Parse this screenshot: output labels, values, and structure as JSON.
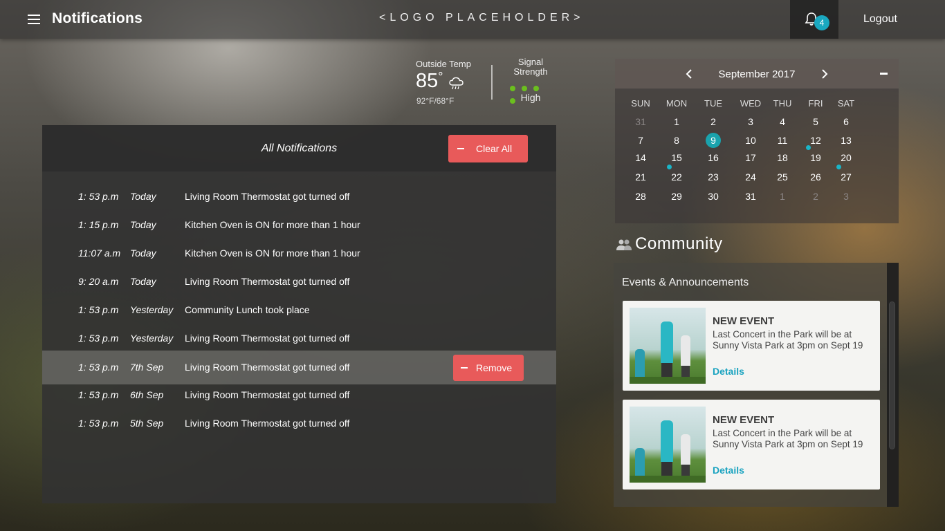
{
  "topbar": {
    "page_title": "Notifications",
    "logo": "<LOGO PLACEHOLDER>",
    "notification_count": "4",
    "logout_label": "Logout"
  },
  "weather": {
    "temp_label": "Outside Temp",
    "temp_value": "85",
    "temp_unit": "°",
    "icon": "rain-cloud-icon",
    "range": "92°F/68°F",
    "signal_label": "Signal Strength",
    "signal_bars": 4,
    "signal_value": "High",
    "signal_color": "#6bbf1e"
  },
  "notifications": {
    "title": "All Notifications",
    "clear_label": "Clear All",
    "remove_label": "Remove",
    "rows": [
      {
        "time": "1: 53 p.m",
        "day": "Today",
        "text": "Living Room Thermostat got turned off"
      },
      {
        "time": "1: 15 p.m",
        "day": "Today",
        "text": "Kitchen Oven is ON for more than 1 hour"
      },
      {
        "time": "11:07 a.m",
        "day": "Today",
        "text": "Kitchen Oven is ON for more than 1 hour"
      },
      {
        "time": "9: 20 a.m",
        "day": "Today",
        "text": "Living Room Thermostat got turned off"
      },
      {
        "time": "1: 53 p.m",
        "day": "Yesterday",
        "text": "Community Lunch took place"
      },
      {
        "time": "1: 53 p.m",
        "day": "Yesterday",
        "text": "Living Room Thermostat got turned off"
      },
      {
        "time": "1: 53 p.m",
        "day": "7th Sep",
        "text": "Living Room Thermostat got turned off"
      },
      {
        "time": "1: 53 p.m",
        "day": "6th Sep",
        "text": "Living Room Thermostat got turned off"
      },
      {
        "time": "1: 53 p.m",
        "day": "5th Sep",
        "text": "Living Room Thermostat got turned off"
      }
    ]
  },
  "calendar": {
    "month": "September 2017",
    "weekdays": [
      "SUN",
      "MON",
      "TUE",
      "WED",
      "THU",
      "FRI",
      "SAT"
    ],
    "weeks": [
      [
        "31",
        "1",
        "2",
        "3",
        "4",
        "5",
        "6"
      ],
      [
        "7",
        "8",
        "9",
        "10",
        "11",
        "12",
        "13"
      ],
      [
        "14",
        "15",
        "16",
        "17",
        "18",
        "19",
        "20"
      ],
      [
        "21",
        "22",
        "23",
        "24",
        "25",
        "26",
        "27"
      ],
      [
        "28",
        "29",
        "30",
        "31",
        "1",
        "2",
        "3"
      ]
    ],
    "today": "9",
    "event_days": [
      "19",
      "22",
      "27"
    ],
    "accent_color": "#1aa3ad"
  },
  "community": {
    "title": "Community",
    "subtitle": "Events & Announcements",
    "events": [
      {
        "kicker": "NEW EVENT",
        "desc": "Last Concert in the Park will be at Sunny Vista Park at 3pm on Sept 19",
        "link": "Details"
      },
      {
        "kicker": "NEW EVENT",
        "desc": "Last Concert in the Park will be at Sunny Vista Park at 3pm on Sept 19",
        "link": "Details"
      }
    ]
  }
}
